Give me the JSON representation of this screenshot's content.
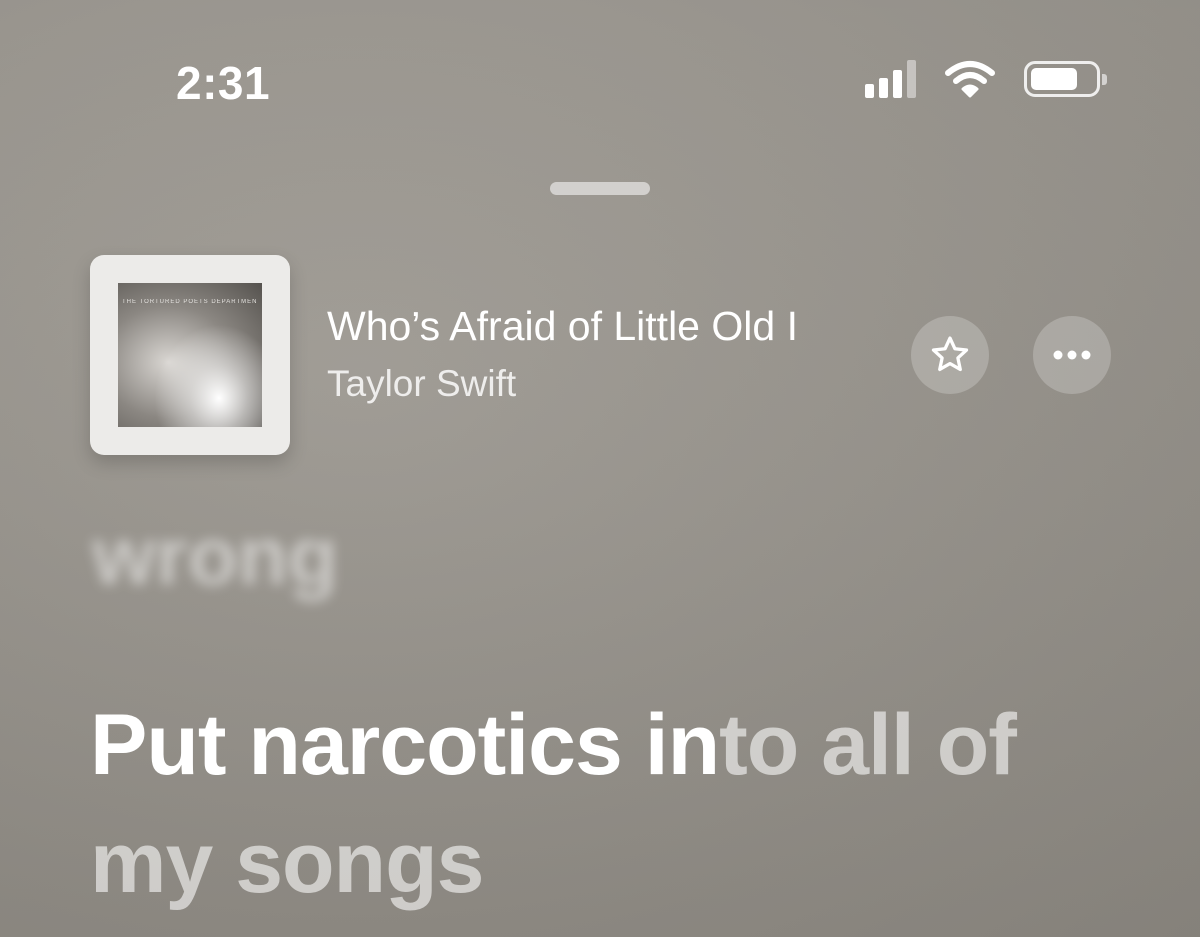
{
  "status_bar": {
    "time": "2:31",
    "icons": [
      "cellular-signal-icon",
      "wifi-icon",
      "battery-icon"
    ]
  },
  "now_playing": {
    "title": "Who’s Afraid of Little Old I",
    "artist": "Taylor Swift",
    "artwork_caption": "THE TORTURED POETS DEPARTMENT",
    "star_icon": "star-outline-icon",
    "more_icon": "ellipsis-icon"
  },
  "lyrics": {
    "previous_line": "wrong",
    "current_sung": "Put narcotics in",
    "current_unsung": "to all of my songs"
  },
  "colors": {
    "background": "#9a968f",
    "text_primary": "#ffffff"
  }
}
